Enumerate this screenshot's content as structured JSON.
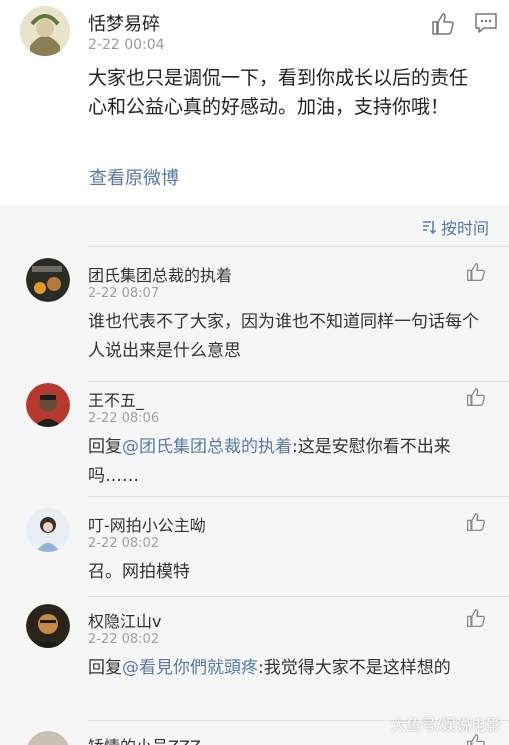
{
  "main_post": {
    "username": "恬梦易碎",
    "time": "2-22 00:04",
    "text": "大家也只是调侃一下，看到你成长以后的责任心和公益心真的好感动。加油，支持你哦！",
    "view_original": "查看原微博"
  },
  "sort": {
    "label": "按时间"
  },
  "comments": [
    {
      "username": "团氏集团总裁的执着",
      "time": "2-22 08:07",
      "prefix": "",
      "mention": "",
      "text": "谁也代表不了大家，因为谁也不知道同样一句话每个人说出来是什么意思"
    },
    {
      "username": "王不五_",
      "time": "2-22 08:06",
      "prefix": "回复",
      "mention": "@团氏集团总裁的执着",
      "text": ":这是安慰你看不出来吗……"
    },
    {
      "username": "叮-网拍小公主呦",
      "time": "2-22 08:02",
      "prefix": "",
      "mention": "",
      "text": "召。网拍模特"
    },
    {
      "username": "权隐江山v",
      "time": "2-22 08:02",
      "prefix": "回复",
      "mention": "@看見你們就頭疼",
      "text": ":我觉得大家不是这样想的"
    },
    {
      "username": "矫情的小号ZZZ",
      "time": "",
      "prefix": "",
      "mention": "",
      "text": ""
    }
  ],
  "watermark": "大鱼号/娱说电影",
  "colors": {
    "link": "#587aa5",
    "comments_bg": "#f6f6f6",
    "time": "#999999"
  }
}
